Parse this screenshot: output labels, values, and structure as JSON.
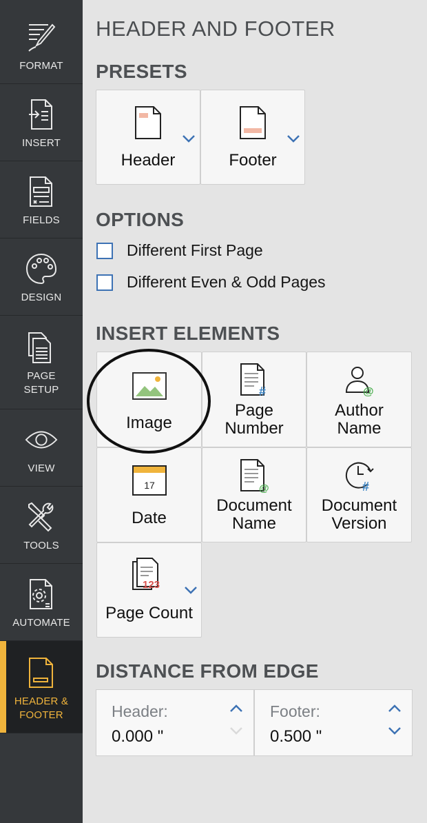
{
  "sidebar": {
    "items": [
      {
        "label": "FORMAT",
        "icon": "pen-icon"
      },
      {
        "label": "INSERT",
        "icon": "insert-document-icon"
      },
      {
        "label": "FIELDS",
        "icon": "fields-document-icon"
      },
      {
        "label": "DESIGN",
        "icon": "palette-icon"
      },
      {
        "label": "PAGE SETUP",
        "label_line1": "PAGE",
        "label_line2": "SETUP",
        "icon": "page-setup-icon"
      },
      {
        "label": "VIEW",
        "icon": "eye-icon"
      },
      {
        "label": "TOOLS",
        "icon": "tools-icon"
      },
      {
        "label": "AUTOMATE",
        "icon": "automate-document-icon"
      },
      {
        "label": "HEADER & FOOTER",
        "label_line1": "HEADER &",
        "label_line2": "FOOTER",
        "icon": "header-footer-icon",
        "active": true
      }
    ]
  },
  "panel": {
    "title": "HEADER AND FOOTER",
    "presets": {
      "heading": "PRESETS",
      "header_label": "Header",
      "footer_label": "Footer"
    },
    "options": {
      "heading": "OPTIONS",
      "different_first_page": "Different First Page",
      "different_even_odd": "Different Even & Odd Pages"
    },
    "insert_elements": {
      "heading": "INSERT ELEMENTS",
      "image": "Image",
      "page_number_1": "Page",
      "page_number_2": "Number",
      "author_name_1": "Author",
      "author_name_2": "Name",
      "date": "Date",
      "date_icon_day": "17",
      "document_name_1": "Document",
      "document_name_2": "Name",
      "document_version_1": "Document",
      "document_version_2": "Version",
      "page_count": "Page Count",
      "page_count_icon_text": "123"
    },
    "distance": {
      "heading": "DISTANCE FROM EDGE",
      "header_label": "Header:",
      "header_value": "0.000 \"",
      "footer_label": "Footer:",
      "footer_value": "0.500 \""
    }
  },
  "colors": {
    "sidebar_bg": "#35383b",
    "active_accent": "#f0b43c",
    "panel_bg": "#e4e4e4",
    "link_blue": "#3d72b4"
  }
}
